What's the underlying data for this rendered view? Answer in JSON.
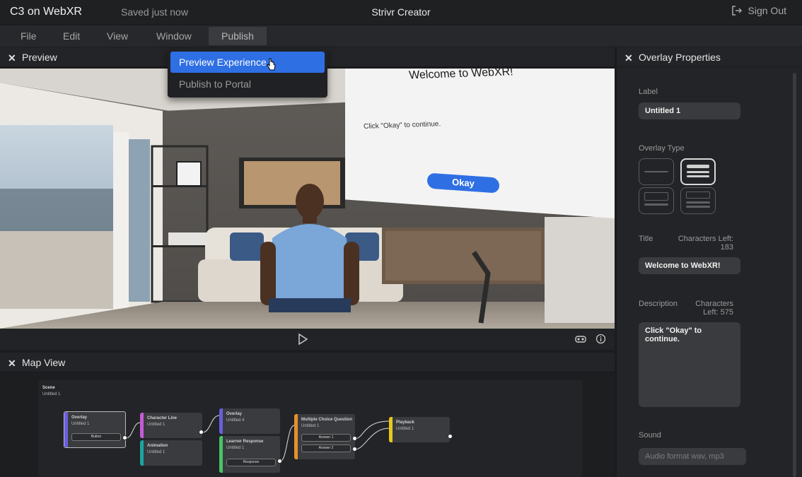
{
  "titlebar": {
    "app_title": "C3 on WebXR",
    "save_status": "Saved just now",
    "center_title": "Strivr Creator",
    "sign_out": "Sign Out"
  },
  "menu": {
    "file": "File",
    "edit": "Edit",
    "view": "View",
    "window": "Window",
    "publish": "Publish"
  },
  "dropdown": {
    "items": [
      "Preview Experience",
      "Publish to Portal"
    ]
  },
  "preview": {
    "title": "Preview",
    "dialog": {
      "title": "Welcome to WebXR!",
      "body": "Click \"Okay\" to continue.",
      "button": "Okay"
    }
  },
  "mapview": {
    "title": "Map View",
    "scene_label": "Scene",
    "scene_name": "Untitled 1",
    "nodes": {
      "overlay1": {
        "title": "Overlay",
        "name": "Untitled 1",
        "button": "Button"
      },
      "charline": {
        "title": "Character Line",
        "name": "Untitled 1"
      },
      "animation": {
        "title": "Animation",
        "name": "Untitled 1"
      },
      "overlay4": {
        "title": "Overlay",
        "name": "Untitled 4"
      },
      "learner": {
        "title": "Learner Response",
        "name": "Untitled 1",
        "button": "Response"
      },
      "mcq": {
        "title": "Multiple Choice Question",
        "name": "Untitled 1",
        "answer1": "Answer 1",
        "answer2": "Answer 2"
      },
      "playback": {
        "title": "Playback",
        "name": "Untitled 1"
      }
    }
  },
  "props": {
    "title": "Overlay Properties",
    "label_caption": "Label",
    "label_value": "Untitled 1",
    "overlay_type_caption": "Overlay Type",
    "title_caption": "Title",
    "title_chars_left": "Characters Left:",
    "title_chars_count": "183",
    "title_value": "Welcome to WebXR!",
    "desc_caption": "Description",
    "desc_chars_left": "Characters",
    "desc_chars_count": "Left: 575",
    "desc_value": "Click \"Okay\" to continue.",
    "sound_caption": "Sound",
    "sound_placeholder": "Audio format wav, mp3"
  },
  "colors": {
    "accent_blue": "#2f6fe4",
    "panel_bg": "#232427",
    "node_overlay": "#6a5fe0",
    "node_character": "#c45bd6",
    "node_animation": "#1aa5a0",
    "node_learner": "#49c46a",
    "node_mcq": "#e8902a",
    "node_playback": "#e8c81a"
  }
}
